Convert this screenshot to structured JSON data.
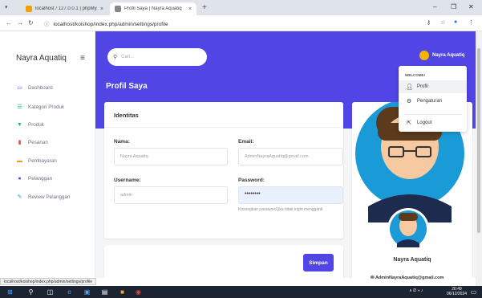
{
  "browser": {
    "tab1_title": "localhost / 127.0.0.1 | phpMyA",
    "tab2_title": "Profil Saya | Nayra Aquatiq",
    "url": "localhost/koishop/index.php/admin/settings/profile",
    "status_url": "localhost/koishop/index.php/admin/settings/profile"
  },
  "sidebar": {
    "brand": "Nayra Aquatiq",
    "items": [
      {
        "label": "Dashboard",
        "icon": "monitor-icon",
        "color": "#4f46e5"
      },
      {
        "label": "Kategori Produk",
        "icon": "list-icon",
        "color": "#10b981"
      },
      {
        "label": "Produk",
        "icon": "cart-icon",
        "color": "#10b981"
      },
      {
        "label": "Pesanan",
        "icon": "receipt-icon",
        "color": "#ef4444"
      },
      {
        "label": "Pembayaran",
        "icon": "money-icon",
        "color": "#f59e0b"
      },
      {
        "label": "Pelanggan",
        "icon": "users-icon",
        "color": "#4f46e5"
      },
      {
        "label": "Review Pelanggan",
        "icon": "edit-icon",
        "color": "#0ea5e9"
      }
    ]
  },
  "header": {
    "search_placeholder": "Cari...",
    "user_name": "Nayra Aquatiq",
    "page_title": "Profil Saya"
  },
  "form": {
    "title": "Identitas",
    "name_label": "Nama:",
    "name_value": "Nayra Aquatiq",
    "email_label": "Email:",
    "email_value": "AdminNayraAquatiq@gmail.com",
    "username_label": "Username:",
    "username_value": "admin",
    "password_label": "Password:",
    "password_value": "••••••••",
    "password_hint": "Kosongkan password jika tidak ingin mengganti",
    "save_label": "Simpan"
  },
  "profile": {
    "name": "Nayra Aquatiq",
    "email": "AdminNayraAquatiq@gmail.com"
  },
  "dropdown": {
    "welcome": "WELCOME!",
    "items": [
      {
        "label": "Profil",
        "icon": "user-icon"
      },
      {
        "label": "Pengaturan",
        "icon": "gear-icon"
      },
      {
        "label": "Logout",
        "icon": "logout-icon"
      }
    ]
  },
  "taskbar": {
    "time": "20:49",
    "date": "06/12/2024"
  },
  "colors": {
    "brand": "#5145e6",
    "sidebar_text": "#6b7280"
  }
}
